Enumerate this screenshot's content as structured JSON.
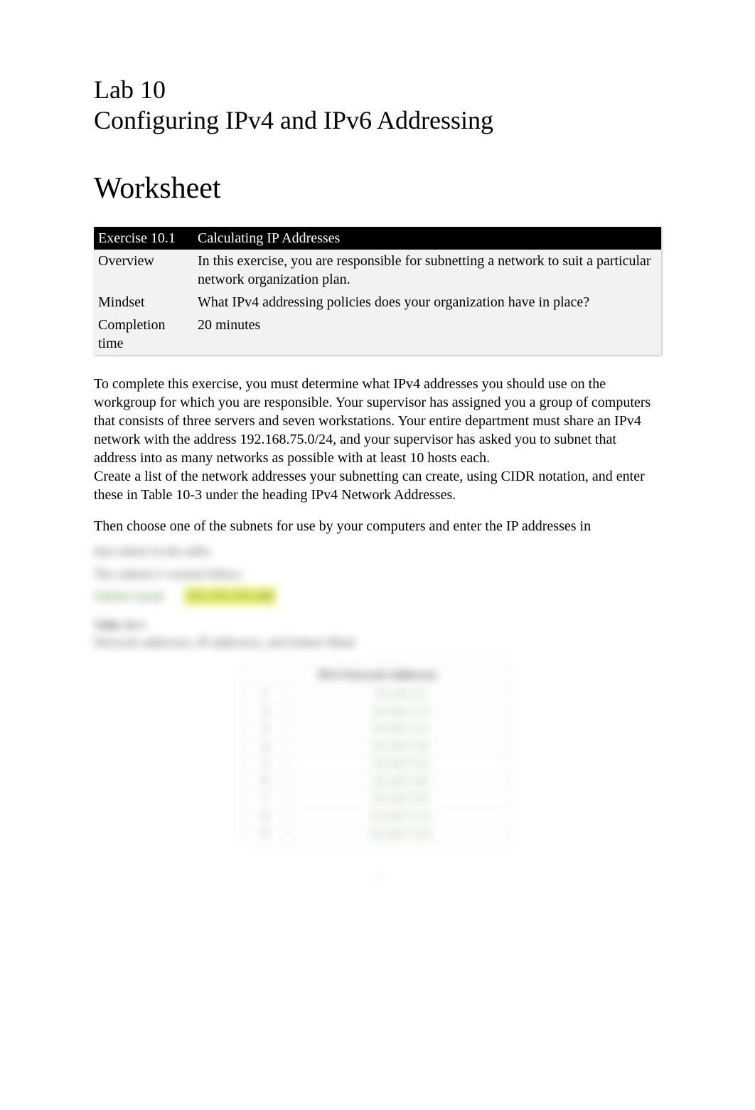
{
  "lab": {
    "number": "Lab 10",
    "title": "Configuring IPv4 and IPv6 Addressing"
  },
  "worksheet_heading": "Worksheet",
  "info_table": {
    "exercise_label": "Exercise 10.1",
    "exercise_title": "Calculating IP Addresses",
    "overview_label": "Overview",
    "overview_text": "In this exercise, you are responsible for subnetting a network to suit a particular network organization plan.",
    "mindset_label": "Mindset",
    "mindset_text": "What IPv4 addressing policies does your organization have in place?",
    "completion_label": "Completion time",
    "completion_text": "20 minutes"
  },
  "paragraphs": {
    "p1": "To complete this exercise, you must determine what IPv4 addresses you should use on the workgroup for which you are responsible. Your supervisor has assigned you a group of computers that consists of three servers and seven workstations. Your entire department must share an IPv4 network with the address 192.168.75.0/24, and your supervisor has asked you to subnet that address into as many networks as possible with at least 10 hosts each.",
    "p2": "Create a list of the network addresses your subnetting can create, using CIDR notation, and enter these in Table 10-3 under the heading IPv4 Network Addresses.",
    "p3": "Then choose one of the subnets for use by your computers and enter the IP addresses in"
  },
  "blurred": {
    "line1": "that subnet in the table.",
    "line2": "The subnets I created follow:",
    "subnet_mask_label": "Subnet mask",
    "subnet_mask_value": "255.255.255.240",
    "table_label": "Table 10-3",
    "table_caption": "Network addresses, IP addresses, and Subnet Mask",
    "header": "IPv4 Network Addresses",
    "rows": [
      {
        "n": "1",
        "v": "192.168.75.0"
      },
      {
        "n": "2",
        "v": "192.168.75.16"
      },
      {
        "n": "3",
        "v": "192.168.75.32"
      },
      {
        "n": "4",
        "v": "192.168.75.48"
      },
      {
        "n": "5",
        "v": "192.168.75.64"
      },
      {
        "n": "6",
        "v": "192.168.75.80"
      },
      {
        "n": "7",
        "v": "192.168.75.96"
      },
      {
        "n": "8",
        "v": "192.168.75.112"
      },
      {
        "n": "9",
        "v": "192.168.75.128"
      }
    ]
  },
  "page_number": "1"
}
